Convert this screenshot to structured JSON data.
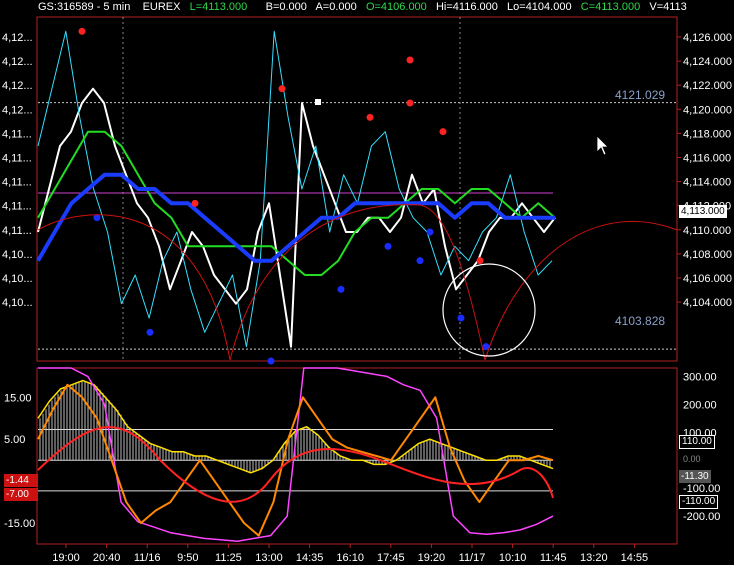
{
  "header": {
    "symbol": "GS:316589 - 5 min",
    "exchange": "EUREX",
    "last": "L=4113.000",
    "bid": "B=0.000",
    "ask": "A=0.000",
    "open": "O=4106.000",
    "high": "Hi=4116.000",
    "low": "Lo=4104.000",
    "close": "C=4113.000",
    "volume": "V=4113"
  },
  "colors": {
    "header_text": "#ffffff",
    "open_text": "#2fd84a",
    "close_text": "#2fd84a",
    "price": "#ffffff",
    "overlay": "#33e0ff",
    "ma_fast": "#22dd22",
    "ma_slow": "#1a3cff",
    "envelope": "#cc1111",
    "dot_red": "#ff2222",
    "dot_blue": "#1a2cff",
    "axis_text": "#ffffff",
    "level_text": "#8aa0c8",
    "osc_yellow": "#ffe000",
    "osc_orange": "#ff8800",
    "osc_magenta": "#ff44ff",
    "osc_red": "#ff2222"
  },
  "upper": {
    "right_ticks": [
      "4,126.000",
      "4,124.000",
      "4,122.000",
      "4,120.000",
      "4,118.000",
      "4,116.000",
      "4,114.000",
      "4,112.000",
      "4,110.000",
      "4,108.000",
      "4,106.000",
      "4,104.000"
    ],
    "left_ticks": [
      "4,12...",
      "4,12...",
      "4,12...",
      "4,12...",
      "4,11...",
      "4,11...",
      "4,11...",
      "4,11...",
      "4,11...",
      "4,10...",
      "4,10...",
      "4,10..."
    ],
    "current_price": "4,113.000",
    "level_high": "4121.029",
    "level_low": "4103.828"
  },
  "lower": {
    "left_ticks": [
      "15.00",
      "5.00",
      "-5.00",
      "-15.00"
    ],
    "right_ticks": [
      "300.00",
      "200.00",
      "100.00",
      "0.00",
      "-100.00",
      "-200.00"
    ],
    "line_110": "110.00",
    "line_m110": "-110.00",
    "current_value": "-11.30",
    "left_badge_1": "-1.44",
    "left_badge_2": "-7.00"
  },
  "x_axis": [
    "19:00",
    "20:40",
    "11/16",
    "9:50",
    "11:25",
    "13:00",
    "14:35",
    "16:10",
    "17:45",
    "19:20",
    "11/17",
    "10:10",
    "11:45",
    "13:20",
    "14:55"
  ],
  "chart_data": [
    {
      "type": "line",
      "subtype": "candlestick-overlay",
      "title": "",
      "ylim": [
        4103,
        4127
      ],
      "reference_levels": [
        4121.029,
        4103.828
      ],
      "series": [
        {
          "values": [
            4112,
            4115,
            4118,
            4119,
            4121,
            4122,
            4121,
            4118,
            4116,
            4114,
            4113,
            4111,
            4108,
            4110,
            4112,
            4111,
            4109,
            4108,
            4107,
            4108,
            4112,
            4114,
            4109,
            4104,
            4121,
            4118,
            4116,
            4114,
            4112,
            4112,
            4113,
            4113,
            4112,
            4113,
            4116,
            4114,
            4115,
            4111,
            4108,
            4109,
            4110,
            4112,
            4113,
            4113,
            4114,
            4113,
            4112,
            4113
          ]
        },
        {
          "values": [
            4118,
            4122,
            4126,
            4120,
            4115,
            4112,
            4107,
            4109,
            4106,
            4110,
            4112,
            4108,
            4105,
            4107,
            4109,
            4104,
            4110,
            4126,
            4120,
            4115,
            4118,
            4112,
            4116,
            4114,
            4118,
            4119,
            4115,
            4113,
            4112,
            4109,
            4111,
            4110,
            4112,
            4113,
            4116,
            4112,
            4109,
            4110
          ]
        },
        {
          "values": [
            4113,
            4115,
            4117,
            4119,
            4119,
            4118,
            4116,
            4114,
            4113,
            4111,
            4111,
            4111,
            4111,
            4111,
            4111,
            4110,
            4109,
            4109,
            4110,
            4112,
            4113,
            4113,
            4114,
            4115,
            4115,
            4114,
            4115,
            4115,
            4114,
            4113,
            4114,
            4113
          ]
        },
        {
          "values": [
            4110,
            4112,
            4114,
            4115,
            4116,
            4116,
            4115,
            4115,
            4114,
            4114,
            4113,
            4112,
            4111,
            4110,
            4110,
            4111,
            4112,
            4113,
            4113,
            4114,
            4114,
            4114,
            4114,
            4114,
            4114,
            4113,
            4114,
            4114,
            4113,
            4113,
            4113,
            4113
          ]
        }
      ],
      "markers": {
        "red": [
          4126,
          4122,
          4114,
          4124,
          4120,
          4121,
          4119,
          4110
        ],
        "blue": [
          4113,
          4105,
          4103,
          4108,
          4111,
          4110,
          4112,
          4106,
          4104
        ]
      }
    },
    {
      "type": "line",
      "subtype": "oscillator",
      "title": "",
      "ylim": [
        -20,
        22
      ],
      "ylim_right": [
        -300,
        330
      ],
      "reference_levels": [
        110,
        0,
        -110
      ],
      "series": [
        {
          "values": [
            10,
            14,
            17,
            18,
            19,
            18,
            15,
            12,
            8,
            6,
            4,
            3,
            2,
            2,
            1,
            1,
            0,
            -1,
            -2,
            -3,
            -2,
            0,
            4,
            7,
            8,
            6,
            3,
            1,
            0,
            0,
            -1,
            -1,
            0,
            2,
            4,
            5,
            4,
            3,
            2,
            1,
            0,
            0,
            1,
            1,
            0,
            -1,
            -2
          ]
        },
        {
          "values": [
            330,
            330,
            330,
            300,
            200,
            -150,
            -220,
            -240,
            -260,
            -270,
            -280,
            -285,
            -290,
            -280,
            -270,
            -200,
            330,
            330,
            330,
            320,
            310,
            300,
            270,
            250,
            150,
            -200,
            -260,
            -265,
            -260,
            -250,
            -230,
            -200
          ]
        },
        {
          "values": [
            5,
            12,
            18,
            15,
            10,
            0,
            -10,
            -15,
            -12,
            -10,
            -5,
            0,
            -5,
            -10,
            -15,
            -18,
            -10,
            5,
            15,
            10,
            5,
            3,
            2,
            1,
            0,
            5,
            10,
            15,
            3,
            -5,
            -10,
            -5,
            0,
            0,
            1,
            0
          ]
        }
      ]
    }
  ]
}
